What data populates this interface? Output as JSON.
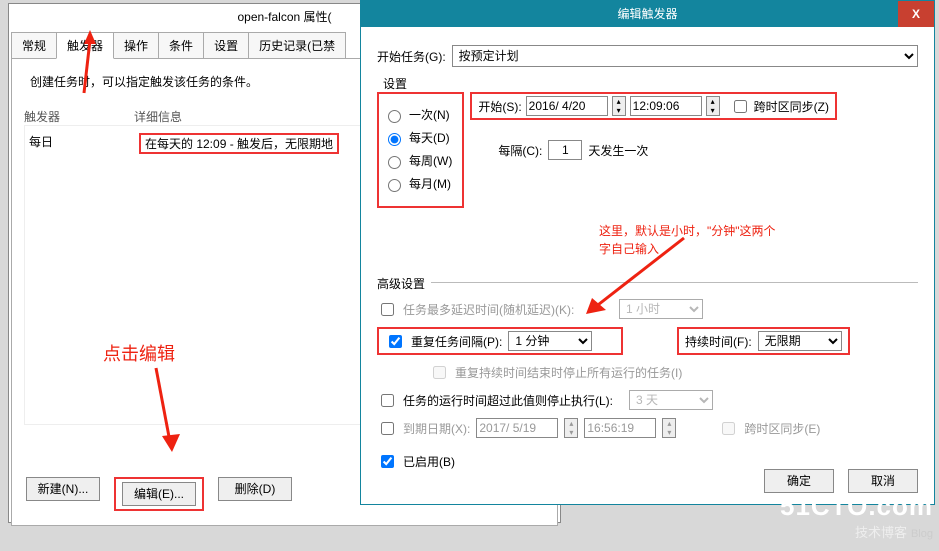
{
  "left_window": {
    "title": "open-falcon 属性(",
    "tabs": [
      "常规",
      "触发器",
      "操作",
      "条件",
      "设置",
      "历史记录(已禁"
    ],
    "active_tab": 1,
    "hint": "创建任务时，可以指定触发该任务的条件。",
    "col_trigger": "触发器",
    "col_detail": "详细信息",
    "row_trigger": "每日",
    "row_detail": "在每天的 12:09 - 触发后，无限期地",
    "btn_new": "新建(N)...",
    "btn_edit": "编辑(E)...",
    "btn_del": "删除(D)"
  },
  "left_note": "点击编辑",
  "trigger_dialog": {
    "title": "编辑触发器",
    "close": "X",
    "start_task_label": "开始任务(G):",
    "start_task_value": "按预定计划",
    "settings_label": "设置",
    "radio_once": "一次(N)",
    "radio_daily": "每天(D)",
    "radio_weekly": "每周(W)",
    "radio_monthly": "每月(M)",
    "start_label": "开始(S):",
    "start_date": "2016/ 4/20",
    "start_time": "12:09:06",
    "tz_sync": "跨时区同步(Z)",
    "every_label": "每隔(C):",
    "every_value": "1",
    "every_unit": "天发生一次",
    "note1_line1": "这里，默认是小时，\"分钟\"这两个",
    "note1_line2": "字自己输入",
    "adv_title": "高级设置",
    "adv_delay": "任务最多延迟时间(随机延迟)(K):",
    "adv_delay_val": "1 小时",
    "adv_repeat": "重复任务间隔(P):",
    "adv_repeat_val": "1 分钟",
    "adv_duration": "持续时间(F):",
    "adv_duration_val": "无限期",
    "adv_stop_running": "重复持续时间结束时停止所有运行的任务(I)",
    "adv_timeout": "任务的运行时间超过此值则停止执行(L):",
    "adv_timeout_val": "3 天",
    "adv_expire": "到期日期(X):",
    "adv_expire_date": "2017/ 5/19",
    "adv_expire_time": "16:56:19",
    "adv_tz2": "跨时区同步(E)",
    "adv_enabled": "已启用(B)",
    "btn_ok": "确定",
    "btn_cancel": "取消"
  },
  "watermark": {
    "line1": "51CTO.com",
    "line2": "技术博客",
    "line3": "Blog"
  }
}
